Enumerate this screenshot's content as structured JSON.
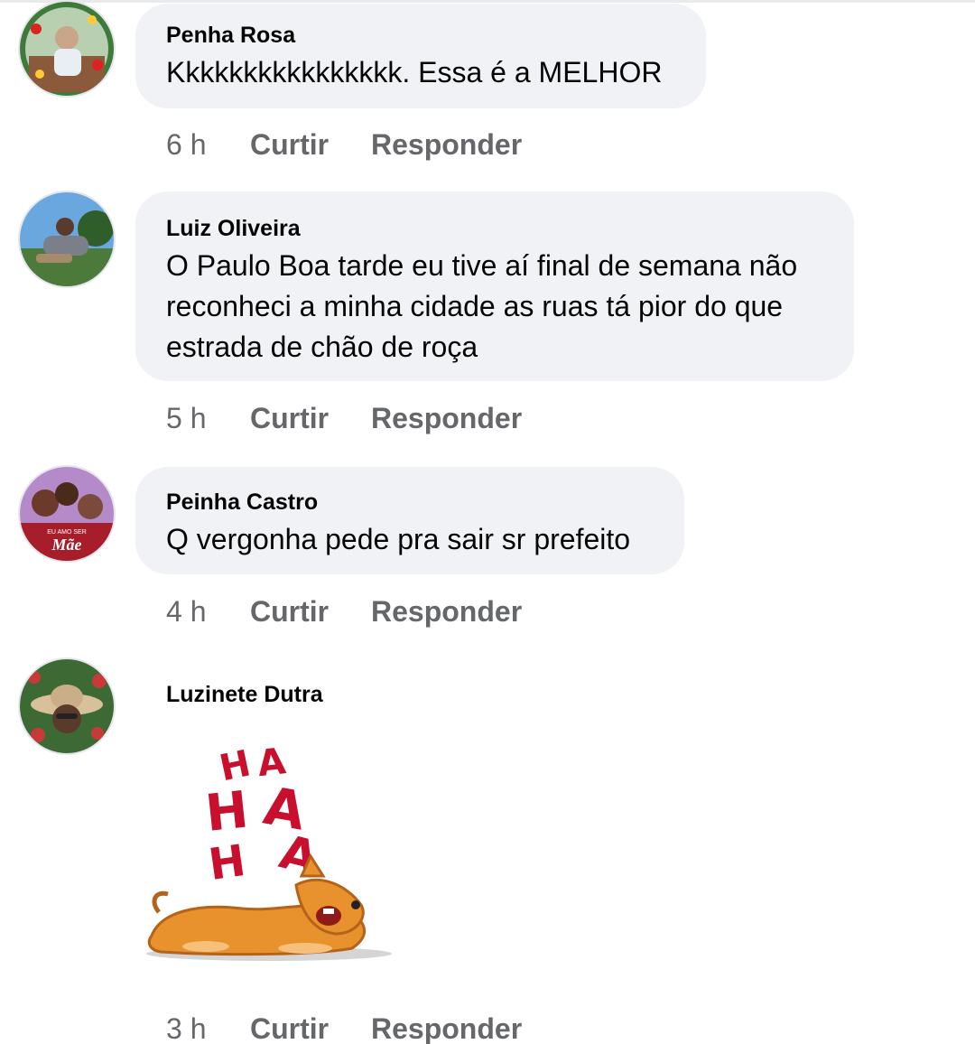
{
  "comments": [
    {
      "author": "Penha Rosa",
      "text": "Kkkkkkkkkkkkkkkk. Essa é a MELHOR",
      "time": "6 h",
      "like": "Curtir",
      "reply": "Responder"
    },
    {
      "author": "Luiz Oliveira",
      "text": "O Paulo Boa tarde eu tive aí final de semana não reconheci a minha cidade as ruas tá pior do que estrada de chão de roça",
      "time": "5 h",
      "like": "Curtir",
      "reply": "Responder"
    },
    {
      "author": "Peinha Castro",
      "text": "Q vergonha pede pra sair sr prefeito",
      "time": "4 h",
      "like": "Curtir",
      "reply": "Responder"
    },
    {
      "author": "Luzinete Dutra",
      "sticker_letters": [
        "H",
        "A",
        "H",
        "A",
        "H",
        "A"
      ],
      "time": "3 h",
      "like": "Curtir",
      "reply": "Responder"
    }
  ],
  "avatar_badge": {
    "line1": "EU AMO SER",
    "line2": "Mãe"
  },
  "colors": {
    "bubble": "#f0f2f5",
    "meta_text": "#65676b",
    "sticker_red": "#c8102e",
    "dog_orange": "#e8922e"
  }
}
